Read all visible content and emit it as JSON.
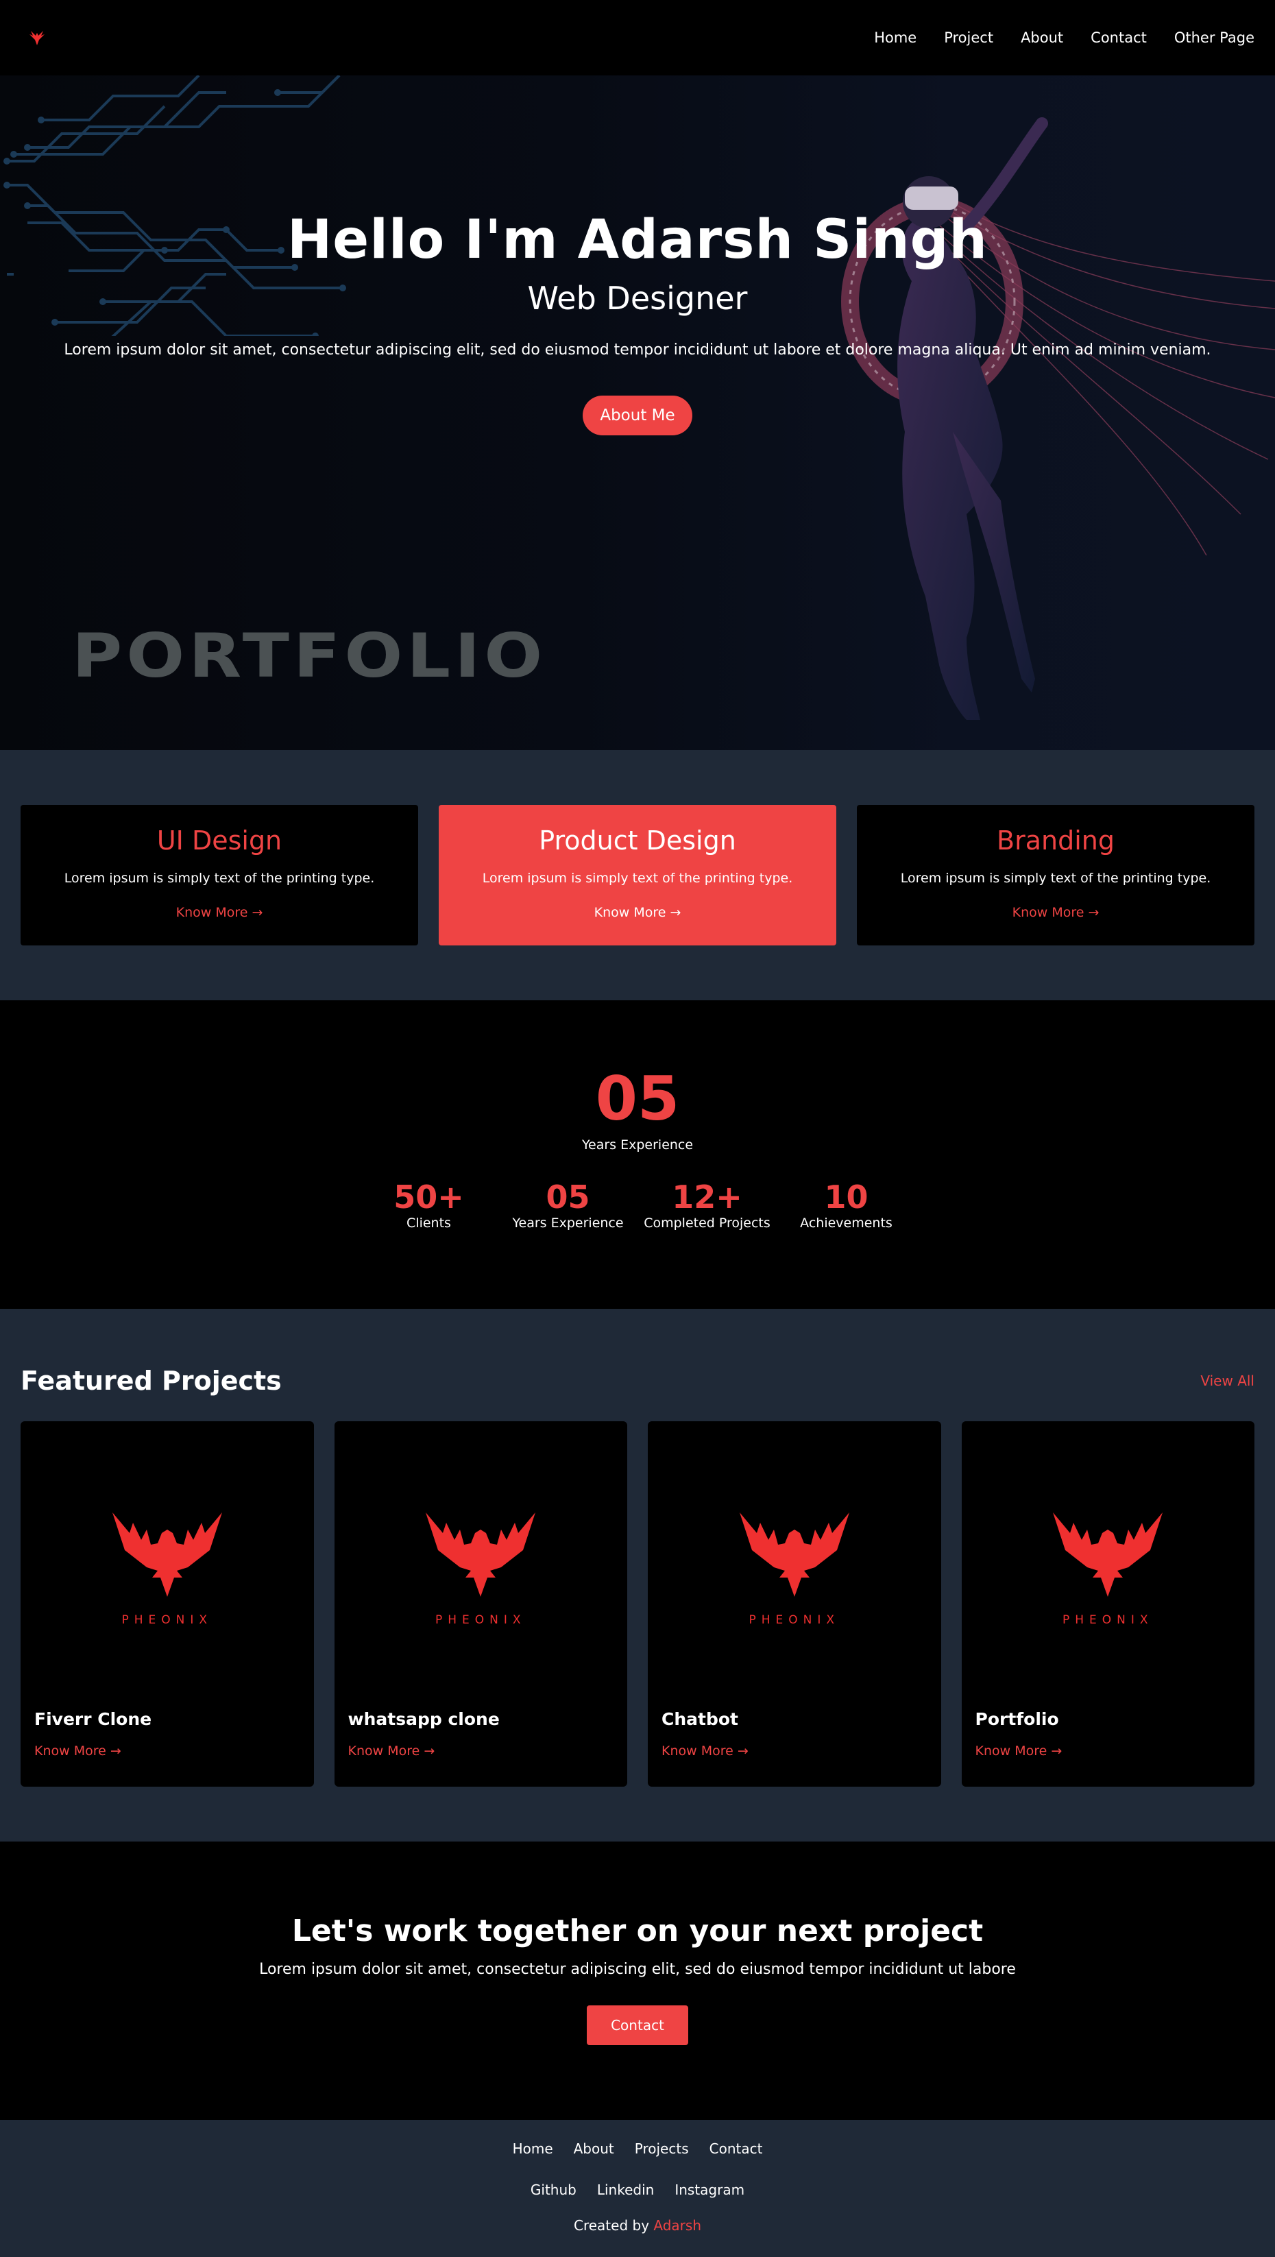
{
  "colors": {
    "accent": "#ef4444",
    "dark": "#000000",
    "panel": "#1f2937",
    "muted_text": "#4b5153"
  },
  "header": {
    "logo_icon": "phoenix-logo-icon",
    "nav": [
      "Home",
      "Project",
      "About",
      "Contact",
      "Other Page"
    ]
  },
  "hero": {
    "title": "Hello I'm Adarsh Singh",
    "subtitle": "Web Designer",
    "text": "Lorem ipsum dolor sit amet, consectetur adipiscing elit, sed do eiusmod tempor incididunt ut labore et dolore magna aliqua. Ut enim ad minim veniam.",
    "button": "About Me",
    "backdrop_word": "PORTFOLIO"
  },
  "services": [
    {
      "title": "UI Design",
      "text": "Lorem ipsum is simply text of the printing type.",
      "link": "Know More →"
    },
    {
      "title": "Product Design",
      "text": "Lorem ipsum is simply text of the printing type.",
      "link": "Know More →"
    },
    {
      "title": "Branding",
      "text": "Lorem ipsum is simply text of the printing type.",
      "link": "Know More →"
    }
  ],
  "stats": {
    "big_number": "05",
    "big_label": "Years Experience",
    "items": [
      {
        "number": "50+",
        "label": "Clients"
      },
      {
        "number": "05",
        "label": "Years Experience"
      },
      {
        "number": "12+",
        "label": "Completed Projects"
      },
      {
        "number": "10",
        "label": "Achievements"
      }
    ]
  },
  "projects": {
    "title": "Featured Projects",
    "view_all": "View All",
    "logo_text": "PHEONIX",
    "items": [
      {
        "name": "Fiverr Clone",
        "link": "Know More →"
      },
      {
        "name": "whatsapp clone",
        "link": "Know More →"
      },
      {
        "name": "Chatbot",
        "link": "Know More →"
      },
      {
        "name": "Portfolio",
        "link": "Know More →"
      }
    ]
  },
  "cta": {
    "title": "Let's work together on your next project",
    "text": "Lorem ipsum dolor sit amet, consectetur adipiscing elit, sed do eiusmod tempor incididunt ut labore",
    "button": "Contact"
  },
  "footer": {
    "nav": [
      "Home",
      "About",
      "Projects",
      "Contact"
    ],
    "social": [
      "Github",
      "Linkedin",
      "Instagram"
    ],
    "credit_prefix": "Created by",
    "credit_author": "Adarsh"
  }
}
